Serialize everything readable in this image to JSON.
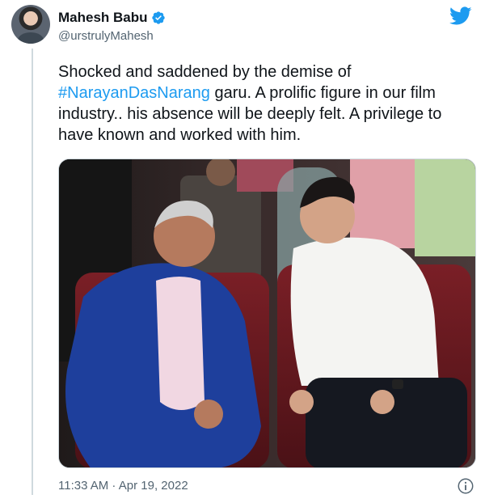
{
  "author": {
    "name": "Mahesh Babu",
    "handle": "@urstrulyMahesh",
    "verified_icon": "verified-badge-icon",
    "avatar": "avatar"
  },
  "tweet": {
    "text_before": "Shocked and saddened by the demise of ",
    "hashtag": "#NarayanDasNarang",
    "text_after": " garu. A prolific figure in our film industry.. his absence will be deeply felt. A privilege to have known and worked with him."
  },
  "meta": {
    "time": "11:33 AM",
    "separator": " · ",
    "date": "Apr 19, 2022"
  },
  "colors": {
    "twitter_blue": "#1d9bf0",
    "text": "#0f1419",
    "secondary": "#536471"
  },
  "icons": {
    "logo": "twitter-bird-icon",
    "info": "info-icon"
  }
}
